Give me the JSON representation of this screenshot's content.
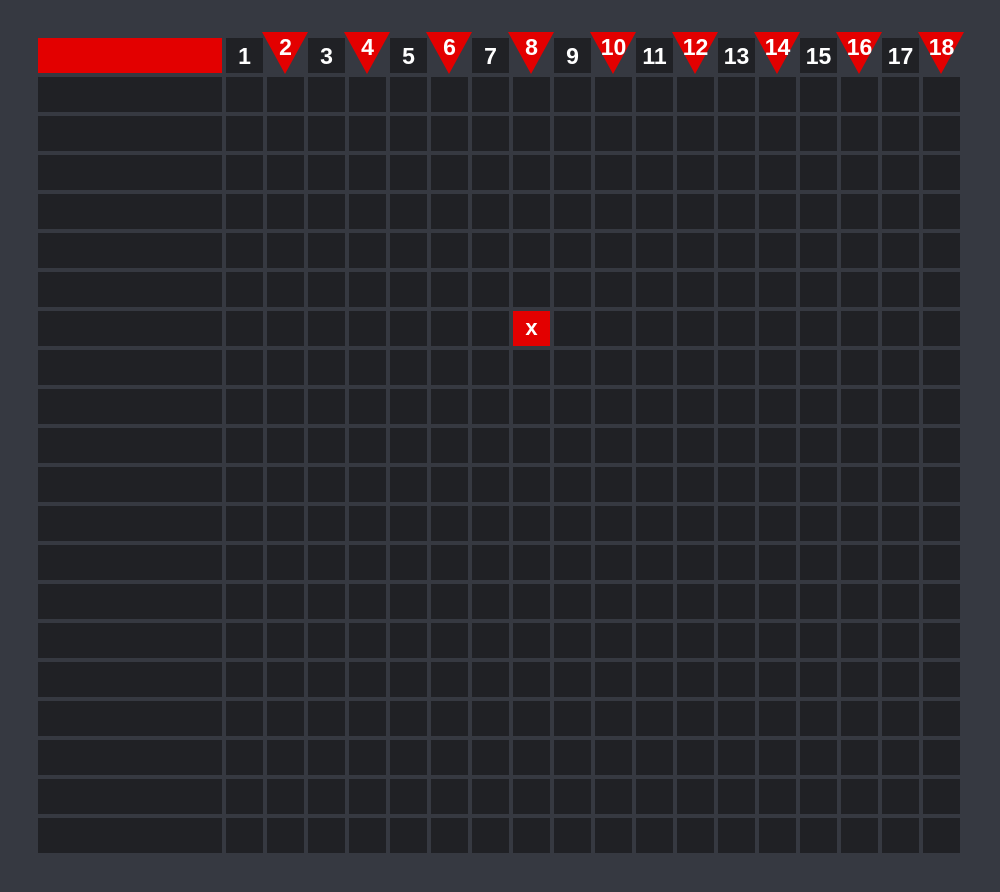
{
  "title_bar": {
    "color": "#e30000",
    "text": ""
  },
  "columns": [
    {
      "label": "1",
      "flag": false
    },
    {
      "label": "2",
      "flag": true
    },
    {
      "label": "3",
      "flag": false
    },
    {
      "label": "4",
      "flag": true
    },
    {
      "label": "5",
      "flag": false
    },
    {
      "label": "6",
      "flag": true
    },
    {
      "label": "7",
      "flag": false
    },
    {
      "label": "8",
      "flag": true
    },
    {
      "label": "9",
      "flag": false
    },
    {
      "label": "10",
      "flag": true
    },
    {
      "label": "11",
      "flag": false
    },
    {
      "label": "12",
      "flag": true
    },
    {
      "label": "13",
      "flag": false
    },
    {
      "label": "14",
      "flag": true
    },
    {
      "label": "15",
      "flag": false
    },
    {
      "label": "16",
      "flag": true
    },
    {
      "label": "17",
      "flag": false
    },
    {
      "label": "18",
      "flag": true
    }
  ],
  "rows": [
    {
      "label": ""
    },
    {
      "label": ""
    },
    {
      "label": ""
    },
    {
      "label": ""
    },
    {
      "label": ""
    },
    {
      "label": ""
    },
    {
      "label": ""
    },
    {
      "label": ""
    },
    {
      "label": ""
    },
    {
      "label": ""
    },
    {
      "label": ""
    },
    {
      "label": ""
    },
    {
      "label": ""
    },
    {
      "label": ""
    },
    {
      "label": ""
    },
    {
      "label": ""
    },
    {
      "label": ""
    },
    {
      "label": ""
    },
    {
      "label": ""
    },
    {
      "label": ""
    }
  ],
  "marks": [
    {
      "row": 7,
      "col": 8,
      "text": "x"
    }
  ],
  "colors": {
    "background": "#363941",
    "cell": "#202125",
    "accent": "#e30000",
    "text": "#ffffff"
  }
}
